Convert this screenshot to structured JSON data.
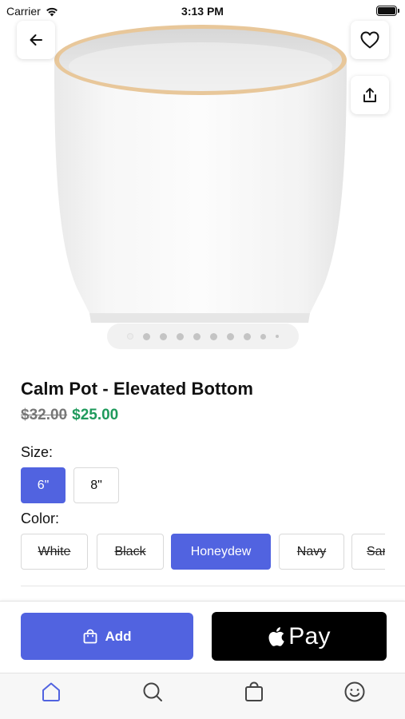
{
  "status_bar": {
    "carrier": "Carrier",
    "time": "3:13 PM"
  },
  "hero": {
    "image_icon": "product-pot-image",
    "carousel": {
      "count": 10,
      "active_index": 0
    }
  },
  "toolbar": {
    "back_icon": "arrow-left-icon",
    "favorite_icon": "heart-icon",
    "share_icon": "share-icon"
  },
  "product": {
    "title": "Calm Pot - Elevated Bottom",
    "price_original": "$32.00",
    "price_sale": "$25.00",
    "sale_color": "#1f9a5c"
  },
  "size": {
    "label": "Size:",
    "options": [
      {
        "label": "6\"",
        "selected": true
      },
      {
        "label": "8\"",
        "selected": false
      }
    ]
  },
  "color": {
    "label": "Color:",
    "options": [
      {
        "label": "White",
        "unavailable": true
      },
      {
        "label": "Black",
        "unavailable": true
      },
      {
        "label": "Honeydew",
        "selected": true
      },
      {
        "label": "Navy",
        "unavailable": true
      },
      {
        "label": "Sand",
        "unavailable": true
      }
    ]
  },
  "actions": {
    "add_label": "Add",
    "add_icon": "bag-icon",
    "pay_label": "Pay",
    "pay_icon": "apple-logo-icon",
    "accent": "#5163e0"
  },
  "tab_bar": {
    "items": [
      {
        "name": "home",
        "icon": "home-icon",
        "active": true
      },
      {
        "name": "search",
        "icon": "search-icon",
        "active": false
      },
      {
        "name": "bag",
        "icon": "bag-icon",
        "active": false
      },
      {
        "name": "account",
        "icon": "smiley-icon",
        "active": false
      }
    ]
  }
}
